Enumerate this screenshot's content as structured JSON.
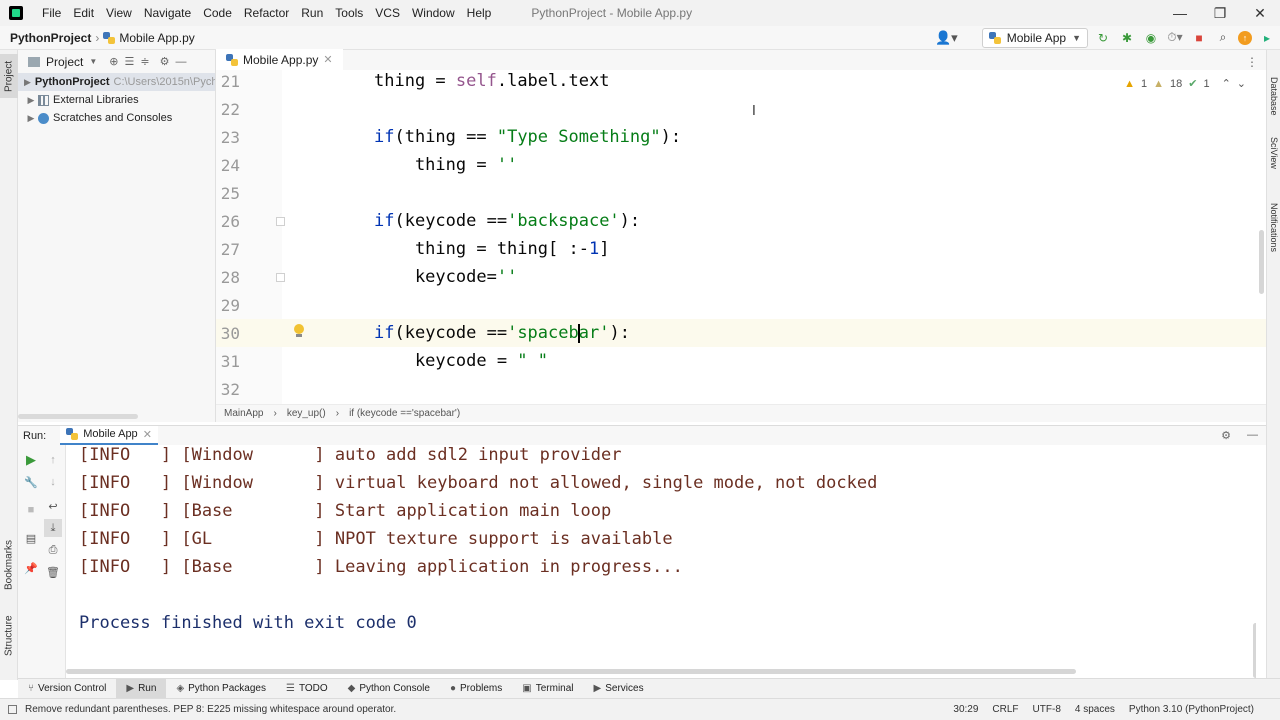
{
  "titlebar": {
    "menu": [
      "File",
      "Edit",
      "View",
      "Navigate",
      "Code",
      "Refactor",
      "Run",
      "Tools",
      "VCS",
      "Window",
      "Help"
    ],
    "window_title": "PythonProject - Mobile App.py",
    "minimize": "—",
    "maximize": "❐",
    "close": "✕"
  },
  "navbar": {
    "project": "PythonProject",
    "file": "Mobile App.py",
    "run_config": "Mobile App"
  },
  "project_panel": {
    "title": "Project",
    "items": [
      {
        "label": "PythonProject",
        "path": "C:\\Users\\2015n\\Pych",
        "icon": "folder-icon"
      },
      {
        "label": "External Libraries",
        "icon": "library-icon"
      },
      {
        "label": "Scratches and Consoles",
        "icon": "scratches-icon"
      }
    ]
  },
  "left_stripe": {
    "project": "Project",
    "bookmarks": "Bookmarks",
    "structure": "Structure"
  },
  "right_stripe": {
    "database": "Database",
    "sciview": "SciView",
    "notifications": "Notifications"
  },
  "editor": {
    "tab": "Mobile App.py",
    "inspections": {
      "warnings": "1",
      "weak_warnings": "18",
      "ok": "1"
    },
    "lines": [
      {
        "n": "21",
        "code": "        thing = self.label.text"
      },
      {
        "n": "22",
        "code": ""
      },
      {
        "n": "23",
        "code": "        if(thing == \"Type Something\"):"
      },
      {
        "n": "24",
        "code": "            thing = ''"
      },
      {
        "n": "25",
        "code": ""
      },
      {
        "n": "26",
        "code": "        if(keycode =='backspace'):"
      },
      {
        "n": "27",
        "code": "            thing = thing[ :-1]"
      },
      {
        "n": "28",
        "code": "            keycode=''"
      },
      {
        "n": "29",
        "code": ""
      },
      {
        "n": "30",
        "code": "        if(keycode =='spacebar'):"
      },
      {
        "n": "31",
        "code": "            keycode = \" \""
      },
      {
        "n": "32",
        "code": ""
      }
    ],
    "breadcrumb": [
      "MainApp",
      "key_up()",
      "if (keycode =='spacebar')"
    ]
  },
  "run_panel": {
    "label": "Run:",
    "tab": "Mobile App",
    "console": [
      "[INFO   ] [Window      ] auto add sdl2 input provider",
      "[INFO   ] [Window      ] virtual keyboard not allowed, single mode, not docked",
      "[INFO   ] [Base        ] Start application main loop",
      "[INFO   ] [GL          ] NPOT texture support is available",
      "[INFO   ] [Base        ] Leaving application in progress...",
      "",
      "Process finished with exit code 0"
    ]
  },
  "tool_bar": {
    "items": [
      "Version Control",
      "Run",
      "Python Packages",
      "TODO",
      "Python Console",
      "Problems",
      "Terminal",
      "Services"
    ]
  },
  "status_bar": {
    "message": "Remove redundant parentheses. PEP 8: E225 missing whitespace around operator.",
    "position": "30:29",
    "line_sep": "CRLF",
    "encoding": "UTF-8",
    "indent": "4 spaces",
    "interpreter": "Python 3.10 (PythonProject)"
  },
  "colors": {
    "keyword_blue": "#0033b3",
    "string_green": "#067d17",
    "self_purple": "#94558d",
    "console_text": "#6b2f22",
    "accent": "#4083c9"
  }
}
